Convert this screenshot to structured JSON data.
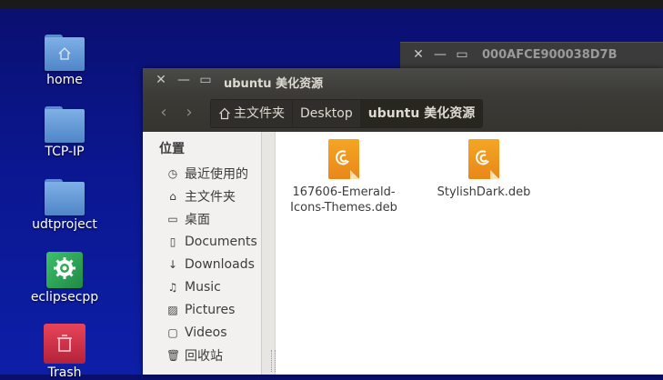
{
  "desktop": {
    "icons": [
      {
        "label": "home"
      },
      {
        "label": "TCP-IP"
      },
      {
        "label": "udtproject"
      },
      {
        "label": "eclipsecpp"
      },
      {
        "label": "Trash"
      }
    ]
  },
  "background_window": {
    "title": "000AFCE900038D7B"
  },
  "window": {
    "title": "ubuntu 美化资源",
    "close_glyph": "✕",
    "minimize_glyph": "—",
    "maximize_glyph": "▭"
  },
  "toolbar": {
    "back_glyph": "‹",
    "forward_glyph": "›",
    "breadcrumbs": [
      {
        "label": "主文件夹"
      },
      {
        "label": "Desktop"
      },
      {
        "label": "ubuntu 美化资源"
      }
    ]
  },
  "sidebar": {
    "heading": "位置",
    "items": [
      {
        "label": "最近使用的",
        "icon": "clock-icon",
        "glyph": "◷"
      },
      {
        "label": "主文件夹",
        "icon": "home-icon",
        "glyph": "⌂"
      },
      {
        "label": "桌面",
        "icon": "desktop-icon",
        "glyph": "▭"
      },
      {
        "label": "Documents",
        "icon": "document-icon",
        "glyph": "▯"
      },
      {
        "label": "Downloads",
        "icon": "download-icon",
        "glyph": "↓"
      },
      {
        "label": "Music",
        "icon": "music-icon",
        "glyph": "♫"
      },
      {
        "label": "Pictures",
        "icon": "picture-icon",
        "glyph": "▨"
      },
      {
        "label": "Videos",
        "icon": "video-icon",
        "glyph": "▢"
      },
      {
        "label": "回收站",
        "icon": "trash-icon",
        "glyph": "🗑"
      }
    ]
  },
  "files": [
    {
      "name": "167606-Emerald-Icons-Themes.deb",
      "icon": "debian-package-icon"
    },
    {
      "name": "StylishDark.deb",
      "icon": "debian-package-icon"
    }
  ],
  "colors": {
    "accent": "#e8871a",
    "titlebar": "#3c3b37",
    "desktop_bg": "#0b1790"
  }
}
